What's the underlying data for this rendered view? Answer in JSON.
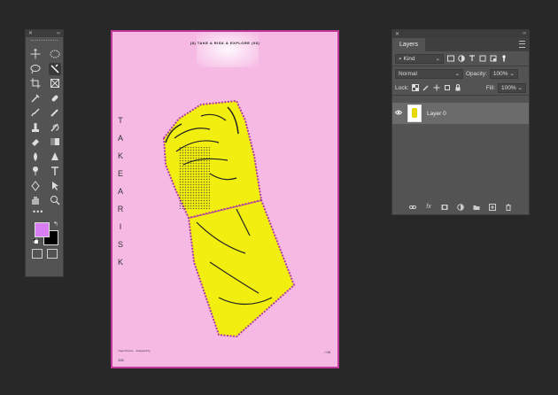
{
  "colors": {
    "foreground": "#d97ef2",
    "background": "#000000",
    "accent": "#c0399a"
  },
  "tools": [
    "move-tool-icon",
    "marquee-tool-icon",
    "lasso-tool-icon",
    "quick-selection-tool-icon",
    "crop-tool-icon",
    "frame-tool-icon",
    "eyedropper-tool-icon",
    "healing-brush-tool-icon",
    "brush-tool-icon",
    "pencil-tool-icon",
    "clone-stamp-tool-icon",
    "history-brush-tool-icon",
    "eraser-tool-icon",
    "gradient-tool-icon",
    "blur-tool-icon",
    "sharpen-tool-icon",
    "dodge-tool-icon",
    "type-tool-icon",
    "pen-tool-icon",
    "path-selection-tool-icon",
    "hand-tool-icon",
    "zoom-tool-icon"
  ],
  "tools_more": "•••",
  "document": {
    "header": "(8) TAKE A RISK & EXPLORE (08)",
    "vertical_letters": [
      "T",
      "A",
      "K",
      "E",
      "A",
      "R",
      "I",
      "S",
      "K"
    ],
    "footer_text": "Yoga Fitness ..\ndesigned by ...",
    "page_left": "106",
    "page_right": "/ 08"
  },
  "layers_panel": {
    "title": "Layers",
    "filter_label": "Kind",
    "blend_mode": "Normal",
    "opacity_label": "Opacity:",
    "opacity_value": "100%",
    "lock_label": "Lock:",
    "fill_label": "Fill:",
    "fill_value": "100%",
    "layers": [
      {
        "name": "Layer 0",
        "visible": true
      }
    ]
  }
}
